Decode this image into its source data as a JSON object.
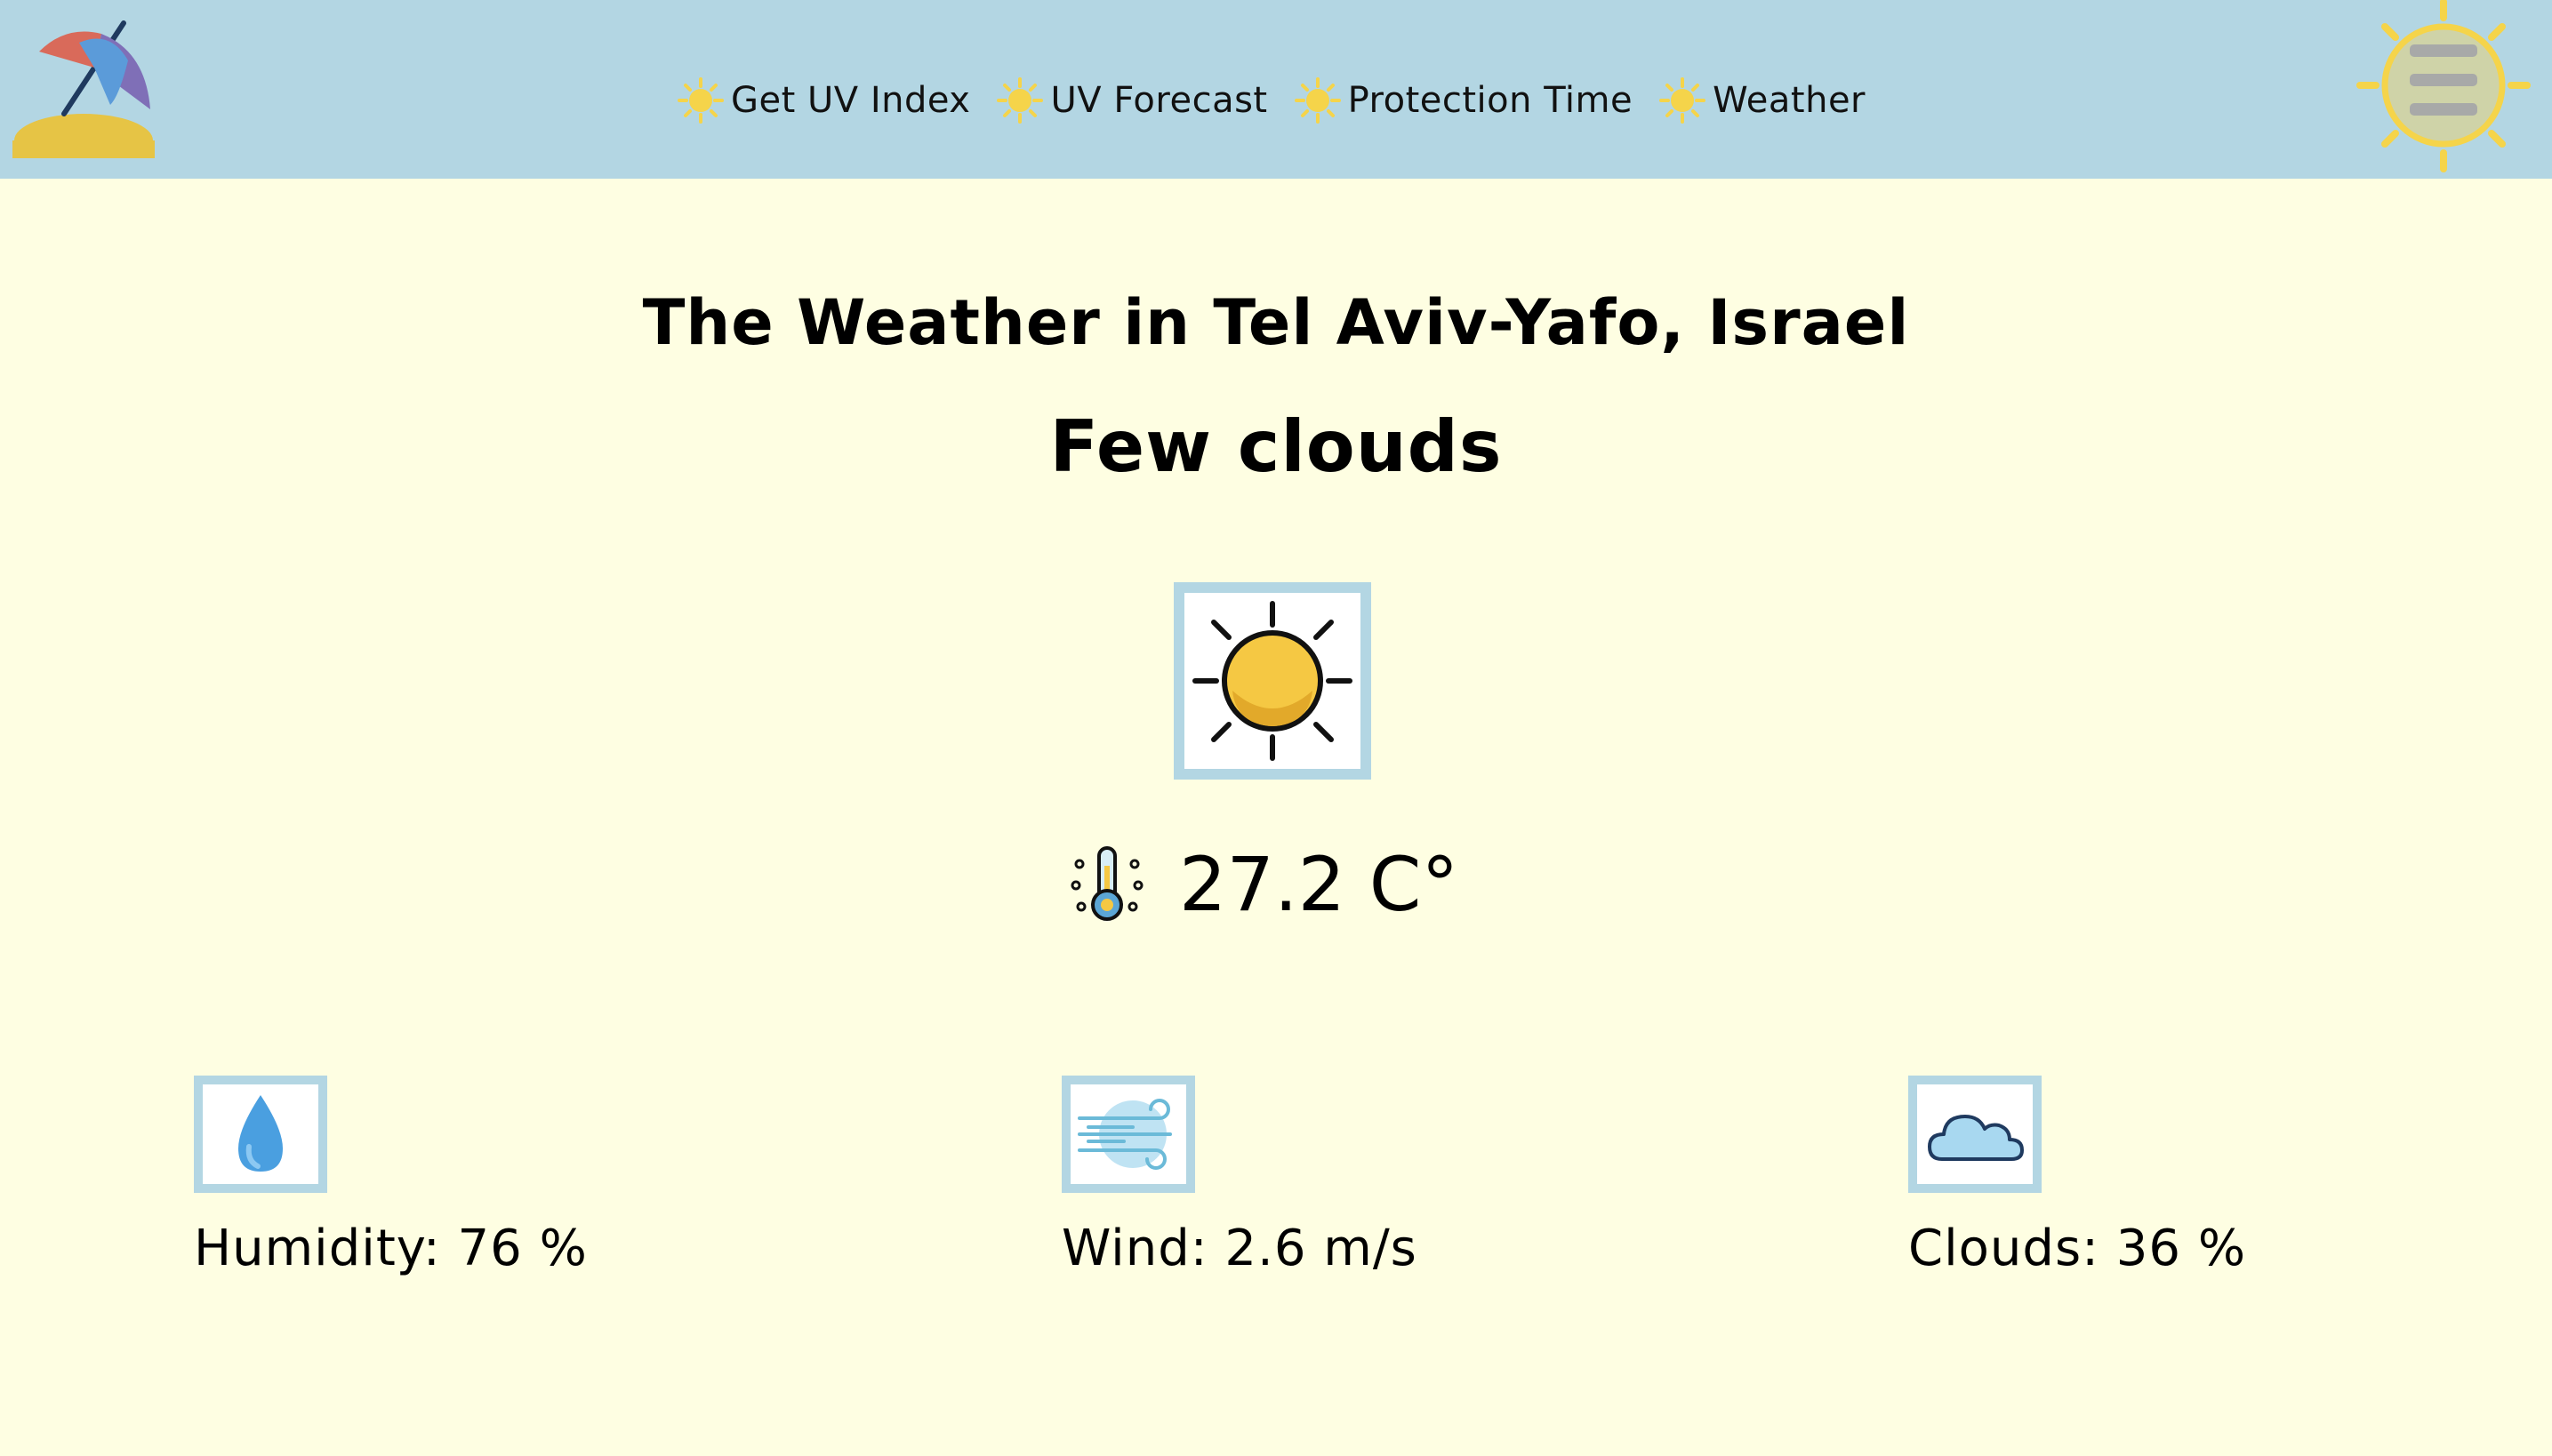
{
  "nav": {
    "links": [
      {
        "label": "Get UV Index"
      },
      {
        "label": "UV Forecast"
      },
      {
        "label": "Protection Time"
      },
      {
        "label": "Weather"
      }
    ],
    "logo_icon": "beach-umbrella-icon",
    "menu_icon": "sun-menu-icon"
  },
  "weather": {
    "title": "The Weather in Tel Aviv-Yafo, Israel",
    "description": "Few clouds",
    "condition_icon": "sun-icon",
    "temperature": "27.2 C°",
    "humidity": "Humidity: 76 %",
    "wind": "Wind: 2.6 m/s",
    "clouds": "Clouds: 36 %"
  },
  "colors": {
    "navbar": "#b3d6e3",
    "background": "#fefee2",
    "sun": "#f5c843",
    "icon_border": "#b3d6e3"
  }
}
